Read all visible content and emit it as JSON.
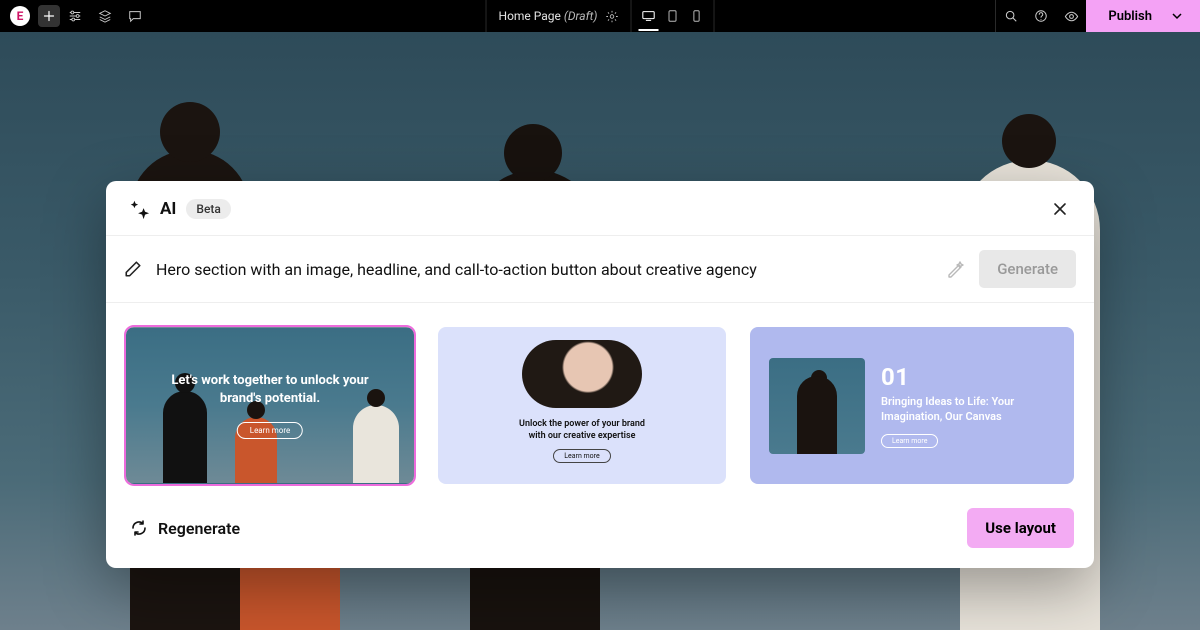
{
  "topbar": {
    "logo_letter": "E",
    "doc_title_main": "Home Page",
    "doc_title_status": "(Draft)",
    "publish_label": "Publish"
  },
  "modal": {
    "title": "AI",
    "badge": "Beta",
    "prompt_value": "Hero section with an image, headline, and call-to-action button about creative agency",
    "generate_label": "Generate",
    "regenerate_label": "Regenerate",
    "use_layout_label": "Use layout"
  },
  "cards": [
    {
      "headline": "Let's work together to unlock your brand's potential.",
      "cta": "Learn more",
      "selected": true
    },
    {
      "headline_line1": "Unlock the power of your brand",
      "headline_line2": "with our creative expertise",
      "cta": "Learn more",
      "selected": false
    },
    {
      "number": "01",
      "headline": "Bringing Ideas to Life: Your Imagination, Our Canvas",
      "cta": "Learn more",
      "selected": false
    }
  ]
}
